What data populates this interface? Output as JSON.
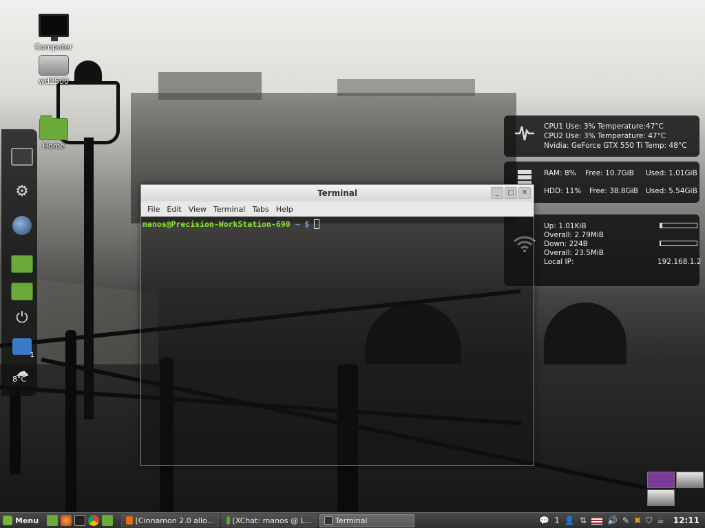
{
  "desktop_icons": [
    {
      "label": "Computer",
      "icon": "computer-icon"
    },
    {
      "label": "wd2500",
      "icon": "hard-drive-icon"
    },
    {
      "label": "Home",
      "icon": "home-folder-icon"
    }
  ],
  "dock": {
    "weather_temp": "8°C",
    "mail_badge": "1"
  },
  "conky": {
    "cpu": {
      "line1": "CPU1  Use: 3%  Temperature:47°C",
      "line2": "CPU2  Use: 3%   Temperature: 47°C",
      "line3": "Nvidia:  GeForce GTX 550 Ti Temp: 48°C"
    },
    "memory": {
      "ram_use": "RAM: 8%",
      "ram_free": "Free: 10.7GiB",
      "ram_used": "Used: 1.01GiB",
      "hdd_use": "HDD: 11%",
      "hdd_free": "Free: 38.8GiB",
      "hdd_used": "Used: 5.54GiB"
    },
    "network": {
      "up": "Up: 1.01KiB",
      "overall_up": "Overall: 2.79MiB",
      "down": "Down: 224B",
      "overall_down": "Overall: 23.5MiB",
      "local_ip_label": "Local IP:",
      "local_ip": "192.168.1.2",
      "up_level": 0.05,
      "down_level": 0.02
    }
  },
  "terminal": {
    "title": "Terminal",
    "menu": [
      "File",
      "Edit",
      "View",
      "Terminal",
      "Tabs",
      "Help"
    ],
    "prompt_user": "manos@Precision-WorkStation-690",
    "prompt_path": "~ $",
    "controls": {
      "minimize": "_",
      "maximize": "□",
      "close": "✕"
    }
  },
  "panel": {
    "menu_label": "Menu",
    "tasks": [
      {
        "label": "[Cinnamon 2.0 allo...",
        "color": "#e06c1c"
      },
      {
        "label": "[XChat: manos @ L...",
        "color": "#5aa832"
      },
      {
        "label": "Terminal",
        "color": "#333333",
        "active": true
      }
    ],
    "tray_count": "1",
    "clock": "12:11"
  },
  "colors": {
    "accent": "#79b43f",
    "prompt_user": "#8ae234",
    "prompt_path": "#729fcf"
  }
}
